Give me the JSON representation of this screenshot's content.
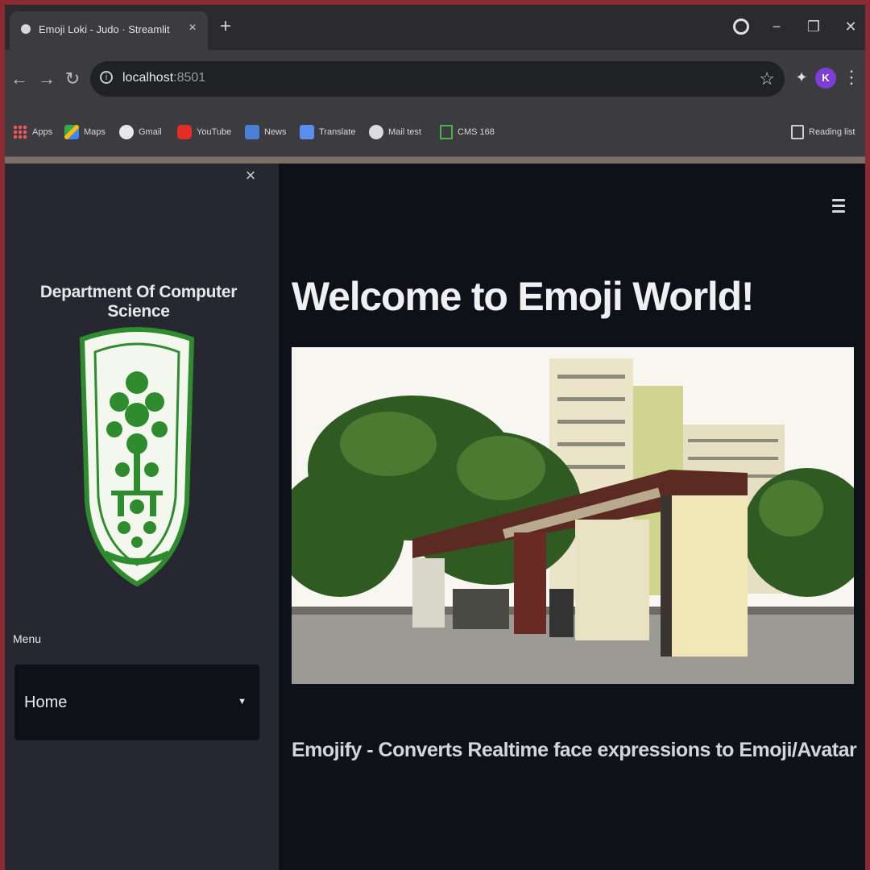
{
  "browser": {
    "tab_title": "Emoji Loki - Judo · Streamlit",
    "tab_close": "×",
    "new_tab": "+",
    "window": {
      "minimize": "−",
      "restore": "❐",
      "close": "✕"
    },
    "url_host": "localhost",
    "url_port": ":8501",
    "profile_initial": "K",
    "bookmarks": [
      {
        "label": "Apps",
        "icon": "apps-grid-icon"
      },
      {
        "label": "Maps",
        "icon": "maps-icon"
      },
      {
        "label": "Gmail",
        "icon": "gmail-icon"
      },
      {
        "label": "YouTube",
        "icon": "youtube-icon"
      },
      {
        "label": "News",
        "icon": "news-icon"
      },
      {
        "label": "Translate",
        "icon": "translate-icon"
      },
      {
        "label": "Mail test",
        "icon": "mail-icon"
      },
      {
        "label": "CMS 168",
        "icon": "cms-icon"
      }
    ],
    "reading_list": "Reading list"
  },
  "sidebar": {
    "close_symbol": "×",
    "department_title": "Department Of Computer Science",
    "menu_label": "Menu",
    "menu_selected": "Home"
  },
  "main": {
    "heading": "Welcome to Emoji World!",
    "tagline": "Emojify - Converts Realtime face expressions to Emoji/Avatar"
  },
  "colors": {
    "sidebar_bg": "#262730",
    "main_bg": "#0e1117",
    "logo_green": "#2e8b2e",
    "profile_purple": "#7b3fd6"
  }
}
